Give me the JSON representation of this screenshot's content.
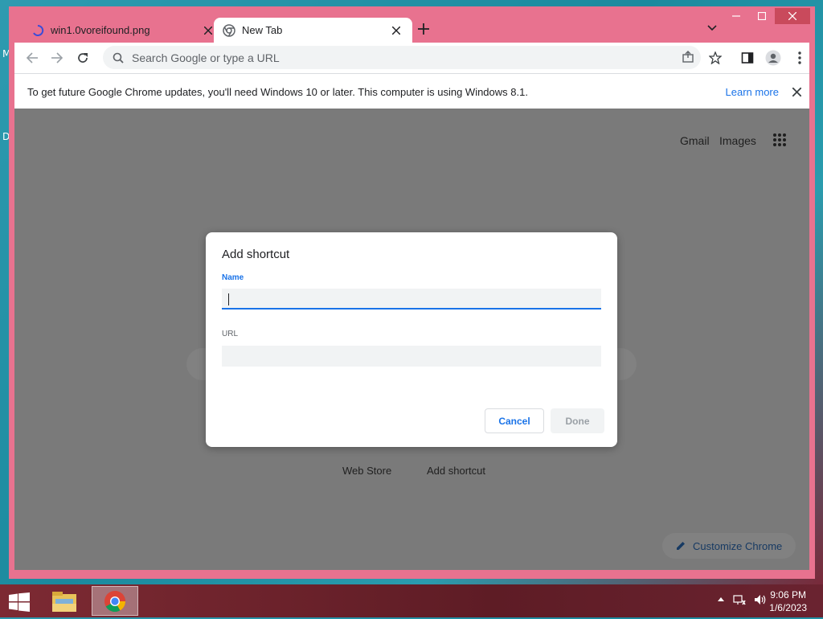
{
  "desktop": {
    "letter_m": "M",
    "letter_d": "D"
  },
  "window": {
    "controls": {
      "minimize": "—",
      "maximize": "☐",
      "close": "✕"
    }
  },
  "tabs": [
    {
      "title": "win1.0voreifound.png",
      "icon": "loading-spinner-icon"
    },
    {
      "title": "New Tab",
      "icon": "chrome-icon"
    }
  ],
  "toolbar": {
    "omnibox_placeholder": "Search Google or type a URL"
  },
  "infobar": {
    "message": "To get future Google Chrome updates, you'll need Windows 10 or later. This computer is using Windows 8.1.",
    "link": "Learn more"
  },
  "ntp": {
    "gmail": "Gmail",
    "images": "Images",
    "shortcuts": [
      "Web Store",
      "Add shortcut"
    ],
    "customize": "Customize Chrome"
  },
  "dialog": {
    "title": "Add shortcut",
    "name_label": "Name",
    "name_value": "",
    "url_label": "URL",
    "url_value": "",
    "cancel": "Cancel",
    "done": "Done"
  },
  "taskbar": {
    "time": "9:06 PM",
    "date": "1/6/2023"
  },
  "colors": {
    "window_frame": "#e8728f",
    "accent": "#1a73e8",
    "overlay": "#7a7a7a"
  }
}
